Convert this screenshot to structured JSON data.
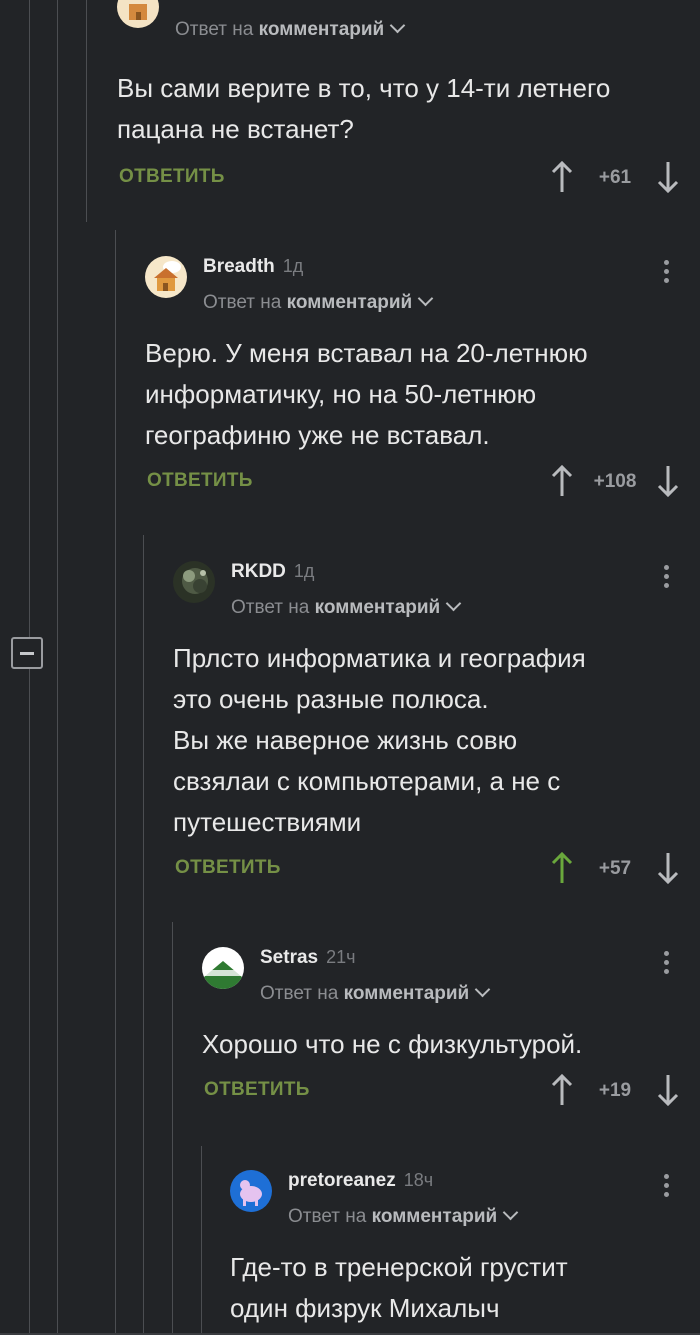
{
  "colors": {
    "background": "#222427",
    "thread_line": "#4c4e52",
    "reply_link": "#759046",
    "upvote_active": "#6aa83c",
    "muted_text": "#8b8d91"
  },
  "thread": {
    "collapse_icon": "minus-square-icon"
  },
  "comments": [
    {
      "username": "",
      "time": "",
      "reply_prefix": "Ответ на",
      "reply_target": "комментарий",
      "text": [
        "Вы сами верите в то, что у 14-ти летнего",
        "пацана не встанет?"
      ],
      "reply_label": "ОТВЕТИТЬ",
      "score": "+61",
      "upvoted": false,
      "avatar": "house-avatar"
    },
    {
      "username": "Breadth",
      "time": "1д",
      "reply_prefix": "Ответ на",
      "reply_target": "комментарий",
      "text": [
        "Верю. У меня вставал на 20-летнюю",
        "информатичку, но на 50-летнюю",
        "географиню уже не вставал."
      ],
      "reply_label": "ОТВЕТИТЬ",
      "score": "+108",
      "upvoted": false,
      "avatar": "house-avatar"
    },
    {
      "username": "RKDD",
      "time": "1д",
      "reply_prefix": "Ответ на",
      "reply_target": "комментарий",
      "text": [
        "Прлсто информатика и география",
        "это очень разные полюса.",
        "Вы же наверное жизнь совю",
        "свзялаи с компьютерами, а не с",
        "путешествиями"
      ],
      "reply_label": "ОТВЕТИТЬ",
      "score": "+57",
      "upvoted": true,
      "avatar": "dark-photo-avatar"
    },
    {
      "username": "Setras",
      "time": "21ч",
      "reply_prefix": "Ответ на",
      "reply_target": "комментарий",
      "text": [
        "Хорошо что не с физкультурой."
      ],
      "reply_label": "ОТВЕТИТЬ",
      "score": "+19",
      "upvoted": false,
      "avatar": "logo-avatar"
    },
    {
      "username": "pretoreanez",
      "time": "18ч",
      "reply_prefix": "Ответ на",
      "reply_target": "комментарий",
      "text": [
        "Где-то в тренерской грустит",
        "один физрук Михалыч"
      ],
      "reply_label": "",
      "score": "",
      "upvoted": false,
      "avatar": "blue-animal-avatar"
    }
  ]
}
